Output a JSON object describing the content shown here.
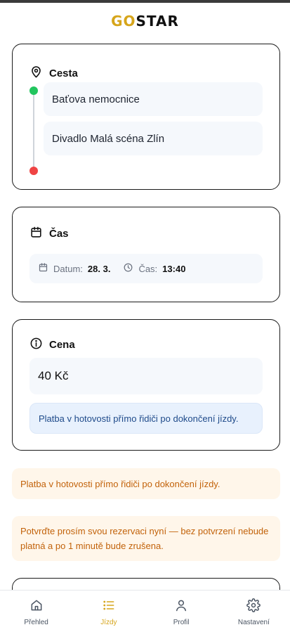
{
  "app": {
    "logo_left": "GO",
    "logo_right": "STAR"
  },
  "route_card": {
    "title": "Cesta",
    "from": "Baťova nemocnice",
    "to": "Divadlo Malá scéna Zlín",
    "icon": "map-pin-icon"
  },
  "time_card": {
    "title": "Čas",
    "date_label": "Datum:",
    "date_value": "28. 3.",
    "time_label": "Čas:",
    "time_value": "13:40",
    "icon": "calendar-icon"
  },
  "price_card": {
    "title": "Cena",
    "price": "40 Kč",
    "payment_note": "Platba v hotovosti přímo řidiči po dokončení jízdy.",
    "icon": "info-icon"
  },
  "notices": {
    "payment": "Platba v hotovosti přímo řidiči po dokončení jízdy.",
    "confirm": "Potvrďte prosím svou rezervaci nyní — bez potvrzení nebude platná a po 1 minutě bude zrušena."
  },
  "nav": {
    "items": [
      {
        "label": "Přehled",
        "icon": "home-icon"
      },
      {
        "label": "Jízdy",
        "icon": "list-icon"
      },
      {
        "label": "Profil",
        "icon": "user-icon"
      },
      {
        "label": "Nastavení",
        "icon": "gear-icon"
      }
    ],
    "active_index": 1
  },
  "colors": {
    "accent": "#d6a51b",
    "start_dot": "#22c55e",
    "end_dot": "#ef4444",
    "notice_bg": "#fff6ea",
    "notice_text": "#c2620a",
    "info_bg": "#e8f1fd",
    "info_text": "#1e4a8a"
  }
}
